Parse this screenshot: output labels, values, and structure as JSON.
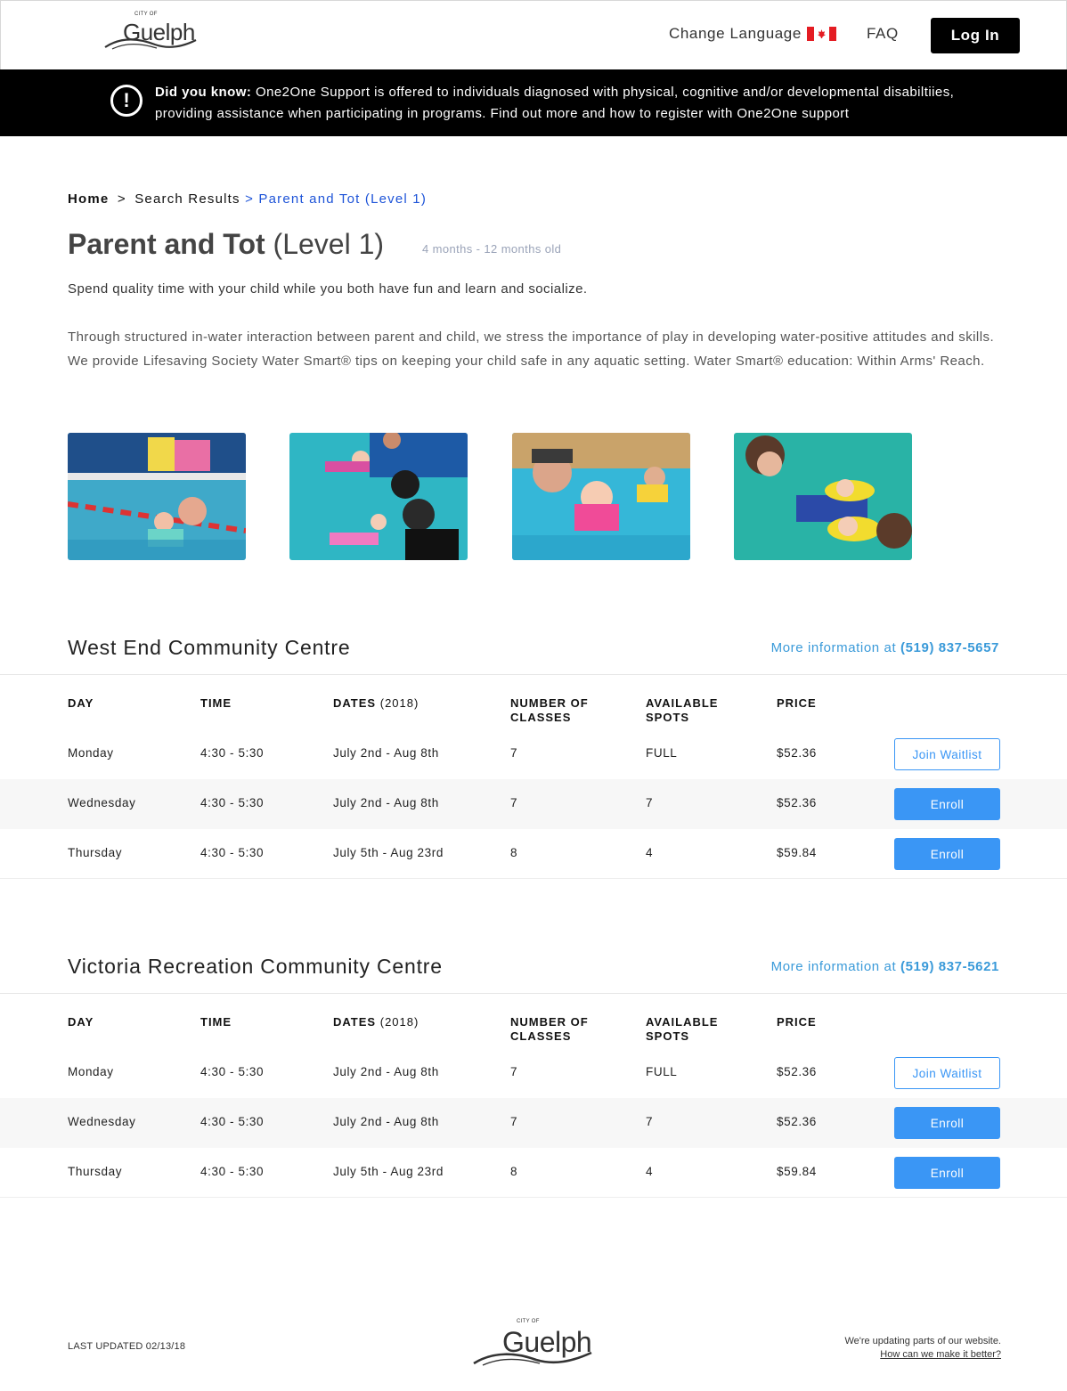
{
  "header": {
    "logo_small": "CITY OF",
    "logo_word": "Guelph",
    "change_language": "Change Language",
    "faq": "FAQ",
    "login": "Log In"
  },
  "banner": {
    "label": "Did you know:",
    "text": " One2One Support is offered to individuals diagnosed with physical, cognitive and/or developmental disabiltiies, providing assistance when participating in programs. Find out more and how to register with One2One support"
  },
  "breadcrumb": {
    "home": "Home",
    "sep1": ">",
    "search": "Search Results",
    "current": "> Parent and Tot (Level 1)"
  },
  "program": {
    "name": "Parent and Tot",
    "level": "(Level 1)",
    "age": "4 months - 12 months old",
    "lead": "Spend quality time with your child while you both have fun and learn and socialize.",
    "description": "Through structured in-water interaction between parent and child, we stress the importance of play in developing water-positive attitudes and skills. We provide Lifesaving Society Water Smart® tips on keeping your child safe in any aquatic setting. Water Smart® education: Within Arms' Reach."
  },
  "table_headers": {
    "day": "DAY",
    "time": "TIME",
    "dates": "DATES",
    "dates_year": "(2018)",
    "classes_1": "NUMBER OF",
    "classes_2": "CLASSES",
    "spots_1": "AVAILABLE",
    "spots_2": "SPOTS",
    "price": "PRICE"
  },
  "locations": [
    {
      "name": "West End Community Centre",
      "info_prefix": "More information at",
      "phone": "(519) 837-5657",
      "rows": [
        {
          "day": "Monday",
          "time": "4:30 - 5:30",
          "dates": "July 2nd - Aug 8th",
          "classes": "7",
          "spots": "FULL",
          "price": "$52.36",
          "action": "Join Waitlist"
        },
        {
          "day": "Wednesday",
          "time": "4:30 - 5:30",
          "dates": "July 2nd - Aug 8th",
          "classes": "7",
          "spots": "7",
          "price": "$52.36",
          "action": "Enroll"
        },
        {
          "day": "Thursday",
          "time": "4:30 - 5:30",
          "dates": "July 5th - Aug 23rd",
          "classes": "8",
          "spots": "4",
          "price": "$59.84",
          "action": "Enroll"
        }
      ]
    },
    {
      "name": "Victoria Recreation Community Centre",
      "info_prefix": "More information at",
      "phone": "(519) 837-5621",
      "rows": [
        {
          "day": "Monday",
          "time": "4:30 - 5:30",
          "dates": "July 2nd - Aug 8th",
          "classes": "7",
          "spots": "FULL",
          "price": "$52.36",
          "action": "Join Waitlist"
        },
        {
          "day": "Wednesday",
          "time": "4:30 - 5:30",
          "dates": "July 2nd - Aug 8th",
          "classes": "7",
          "spots": "7",
          "price": "$52.36",
          "action": "Enroll"
        },
        {
          "day": "Thursday",
          "time": "4:30 - 5:30",
          "dates": "July 5th - Aug 23rd",
          "classes": "8",
          "spots": "4",
          "price": "$59.84",
          "action": "Enroll"
        }
      ]
    }
  ],
  "footer": {
    "last_updated": "LAST UPDATED 02/13/18",
    "updating": "We're updating parts of our website.",
    "feedback_link": "How can we make it better?"
  },
  "colors": {
    "accent_blue": "#3a96f5",
    "breadcrumb_blue": "#1e54d8",
    "banner_bg": "#000000"
  }
}
